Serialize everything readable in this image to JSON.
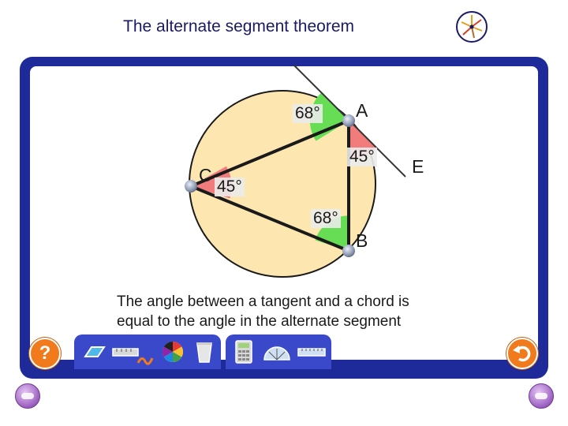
{
  "page": {
    "title": "The alternate segment theorem"
  },
  "diagram": {
    "points": {
      "A": "A",
      "B": "B",
      "C": "C",
      "E": "E"
    },
    "angles": {
      "at_A_tangent": "68°",
      "at_A_chord": "45°",
      "at_C": "45°",
      "at_B": "68°"
    },
    "caption_line1": "The angle between a tangent and a chord is",
    "caption_line2": "equal to the angle in the alternate segment"
  },
  "toolbar": {
    "help_label": "?",
    "tools": [
      "parallelogram-icon",
      "ruler-icon",
      "pencil-icon",
      "colour-wheel-icon",
      "bin-icon",
      "calculator-icon",
      "protractor-icon",
      "measure-icon"
    ]
  },
  "colors": {
    "frame": "#1e2a9a",
    "circle_fill": "#fde6b0",
    "green_sector": "#66dd55",
    "red_sector": "#f27b7b",
    "accent_orange": "#f07a1c"
  }
}
